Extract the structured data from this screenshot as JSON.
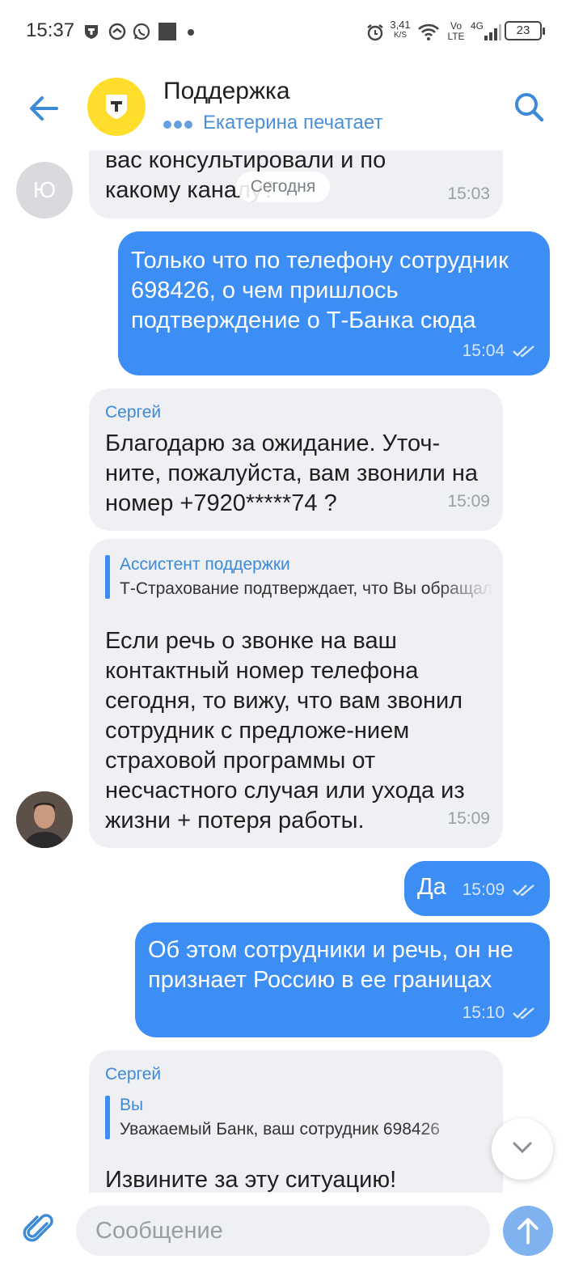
{
  "status_bar": {
    "time": "15:37",
    "speed_value": "3,41",
    "speed_unit": "K/S",
    "network_vo": "Vo",
    "network_lte": "LTE",
    "network_4g": "4G",
    "battery": "23"
  },
  "header": {
    "title": "Поддержка",
    "typing_status": "Екатерина печатает"
  },
  "chat": {
    "date_chip": "Сегодня",
    "first_avatar_letter": "Ю",
    "messages": [
      {
        "direction": "in",
        "text_line1": "вас консультировали и по",
        "text_line2": "какому каналу?",
        "time": "15:03"
      },
      {
        "direction": "out",
        "text": "Только что по телефону сотрудник 698426, о чем пришлось подтверждение о Т-Банка сюда",
        "time": "15:04"
      },
      {
        "direction": "in",
        "sender": "Сергей",
        "text": "Благодарю за ожидание. Уточ-ните, пожалуйста, вам звонили на номер +7920*****74 ?",
        "time": "15:09"
      },
      {
        "direction": "in",
        "quote_author": "Ассистент поддержки",
        "quote_text": "Т-Страхование подтверждает, что Вы обращались",
        "text": "Если речь о звонке на ваш контактный номер телефона сегодня, то вижу, что вам звонил сотрудник с предложе-нием страховой программы от несчастного случая или ухода из жизни + потеря работы.",
        "time": "15:09"
      },
      {
        "direction": "out",
        "text": "Да",
        "time": "15:09"
      },
      {
        "direction": "out",
        "text": "Об этом сотрудники и речь, он не признает Россию в ее границах",
        "time": "15:10"
      },
      {
        "direction": "in",
        "sender": "Сергей",
        "quote_author": "Вы",
        "quote_text": "Уважаемый Банк, ваш сотрудник 698426",
        "text": "Извините за эту ситуацию!"
      }
    ]
  },
  "composer": {
    "placeholder": "Сообщение"
  },
  "colors": {
    "accent": "#3c8ef5",
    "bank_yellow": "#ffdd2d",
    "incoming_bubble": "#eef0f3",
    "link_blue": "#3d8ad8"
  }
}
